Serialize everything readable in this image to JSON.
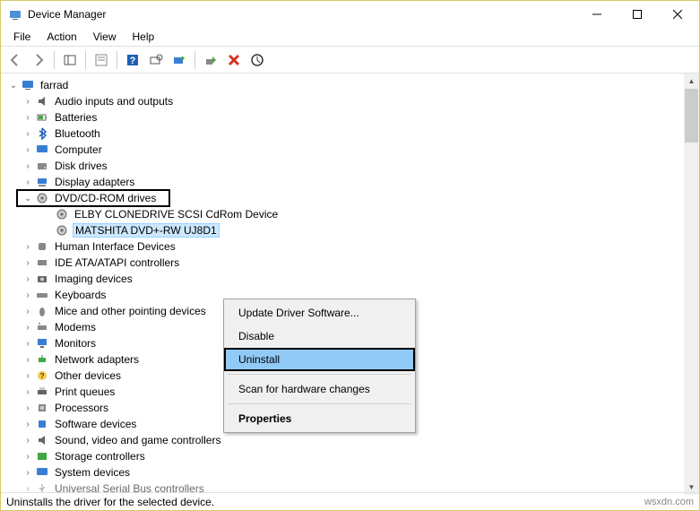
{
  "window": {
    "title": "Device Manager"
  },
  "menubar": {
    "items": [
      "File",
      "Action",
      "View",
      "Help"
    ]
  },
  "tree": {
    "root": "farrad",
    "categories": [
      "Audio inputs and outputs",
      "Batteries",
      "Bluetooth",
      "Computer",
      "Disk drives",
      "Display adapters",
      "DVD/CD-ROM drives",
      "Human Interface Devices",
      "IDE ATA/ATAPI controllers",
      "Imaging devices",
      "Keyboards",
      "Mice and other pointing devices",
      "Modems",
      "Monitors",
      "Network adapters",
      "Other devices",
      "Print queues",
      "Processors",
      "Software devices",
      "Sound, video and game controllers",
      "Storage controllers",
      "System devices",
      "Universal Serial Bus controllers"
    ],
    "dvd_children": [
      "ELBY CLONEDRIVE SCSI CdRom Device",
      "MATSHITA DVD+-RW UJ8D1"
    ]
  },
  "context_menu": {
    "items": {
      "update": "Update Driver Software...",
      "disable": "Disable",
      "uninstall": "Uninstall",
      "scan": "Scan for hardware changes",
      "properties": "Properties"
    }
  },
  "statusbar": {
    "text": "Uninstalls the driver for the selected device.",
    "watermark": "wsxdn.com"
  }
}
